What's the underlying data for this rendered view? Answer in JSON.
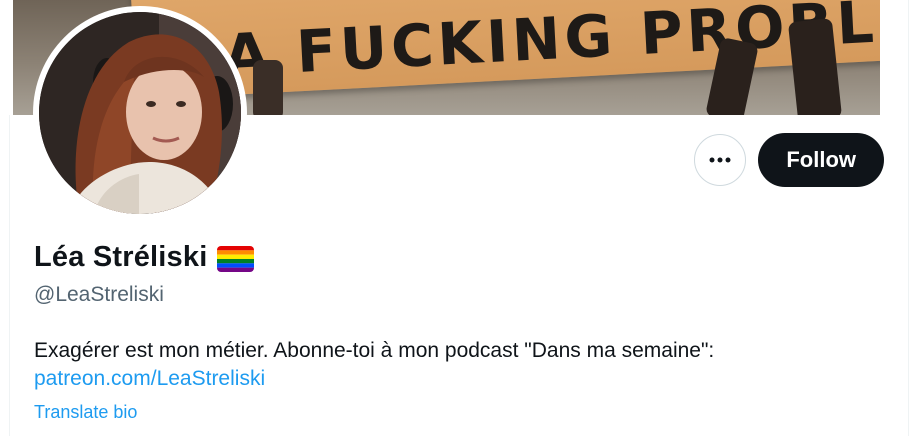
{
  "banner": {
    "sign_text": "A FUCKING PROBLEM",
    "image_name": "protest-sign-banner-image"
  },
  "avatar": {
    "image_name": "profile-photo"
  },
  "actions": {
    "more_icon": "more-horizontal-icon",
    "follow_label": "Follow"
  },
  "profile": {
    "display_name": "Léa Stréliski",
    "name_badge_icon": "rainbow-flag-icon",
    "handle": "@LeaStreliski",
    "bio": "Exagérer est mon métier. Abonne-toi à mon podcast \"Dans ma semaine\":",
    "bio_link": "patreon.com/LeaStreliski",
    "translate_label": "Translate bio"
  },
  "colors": {
    "link": "#1d9bf0",
    "follow_bg": "#0f1419",
    "secondary_text": "#536471",
    "flag": [
      "#e40303",
      "#ff8c00",
      "#ffed00",
      "#008026",
      "#004dff",
      "#750787"
    ]
  }
}
